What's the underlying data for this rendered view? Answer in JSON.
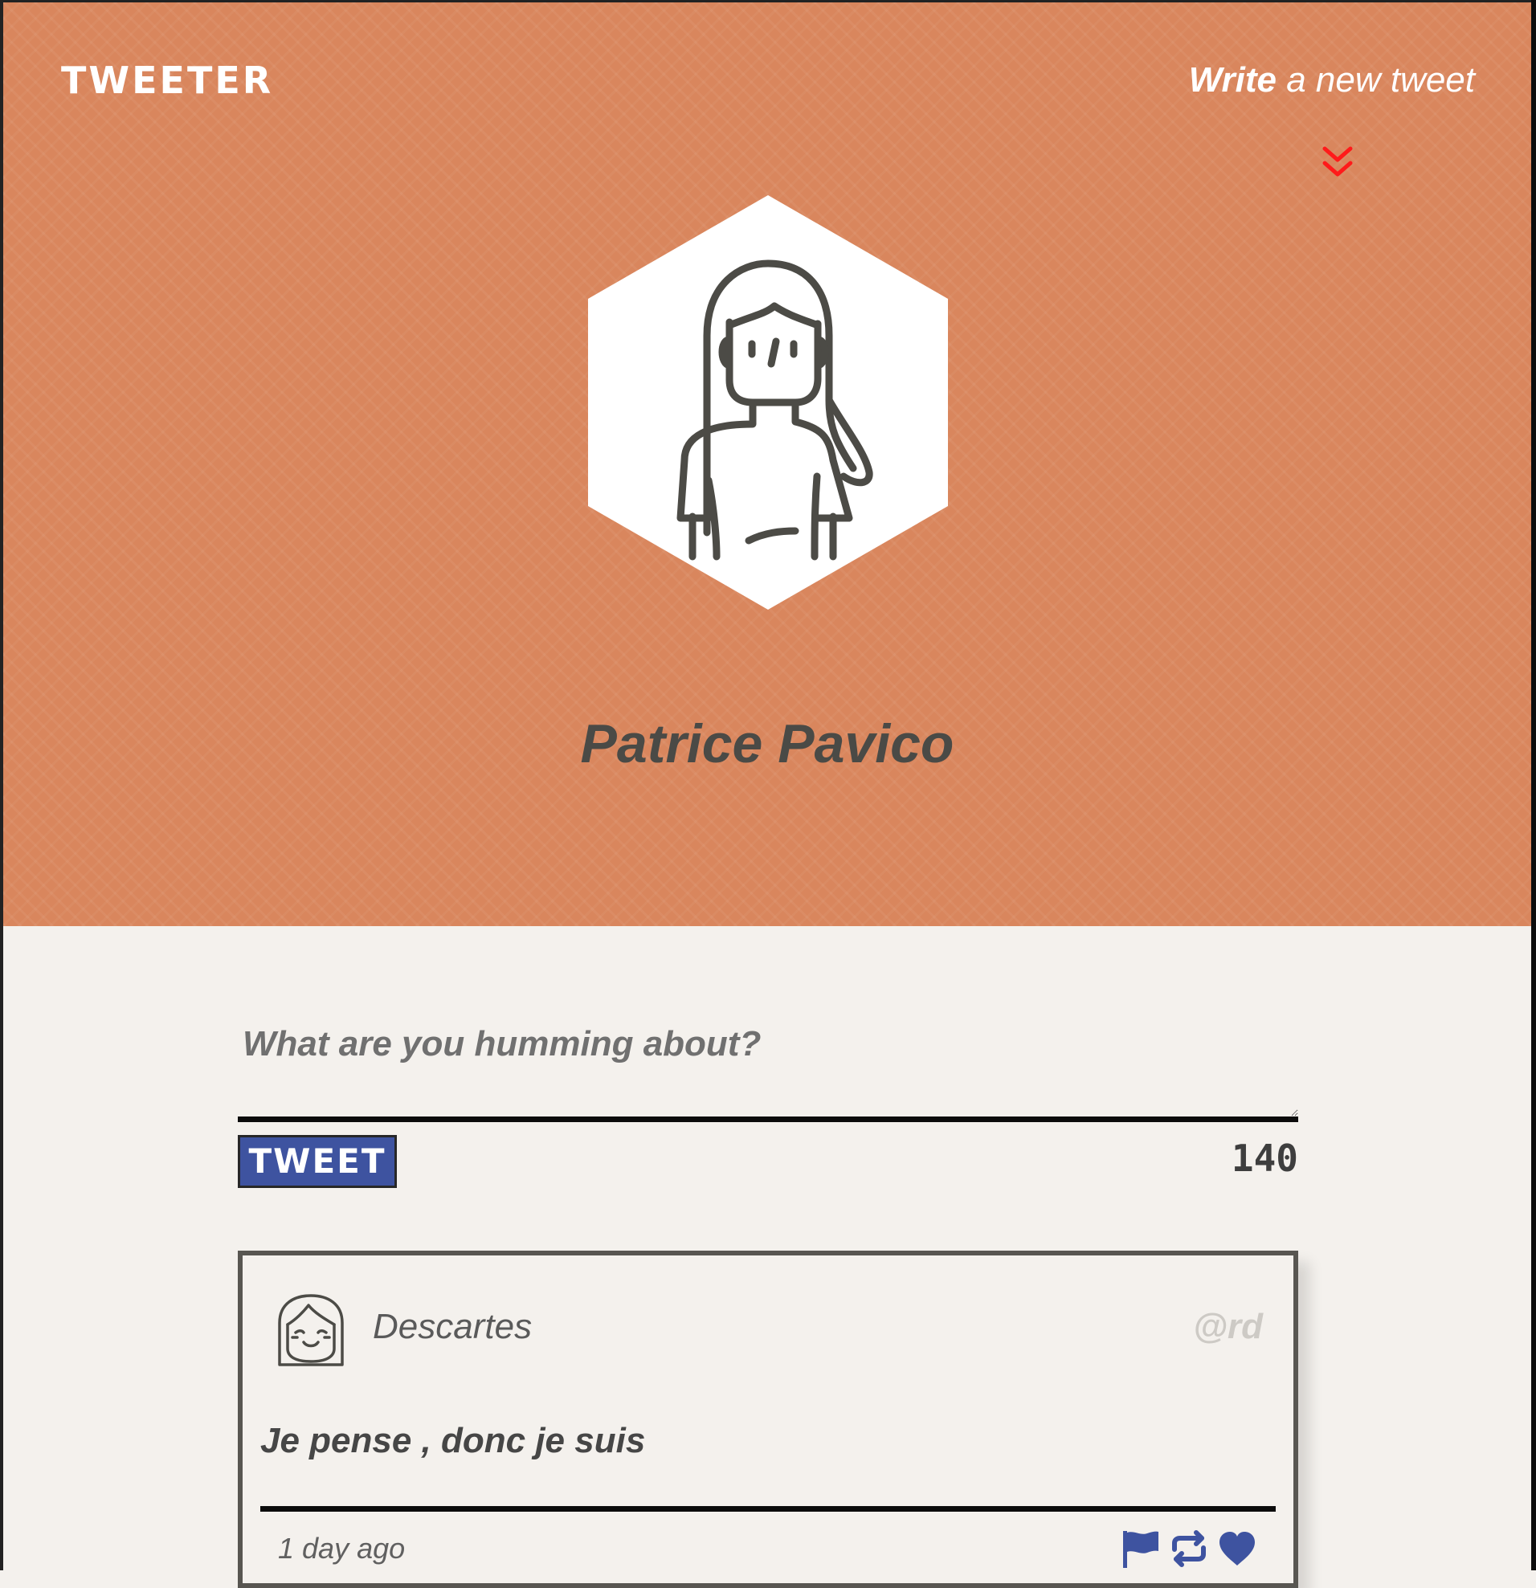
{
  "app": {
    "brand": "TWEETER"
  },
  "header": {
    "compose_toggle_strong": "Write",
    "compose_toggle_rest": "a new tweet",
    "user_name": "Patrice Pavico"
  },
  "compose": {
    "placeholder": "What are you humming about?",
    "value": "",
    "submit_label": "TWEET",
    "char_counter": "140"
  },
  "tweets": [
    {
      "author": "Descartes",
      "handle": "@rd",
      "text": "Je pense , donc je suis",
      "time": "1 day ago",
      "actions": [
        "flag-icon",
        "retweet-icon",
        "heart-icon"
      ]
    }
  ],
  "icons": {
    "chevron": "double-chevron-down-icon",
    "profile_avatar": "hexagon-avatar-icon",
    "tweet_avatar": "girl-avatar-icon"
  },
  "colors": {
    "header_bg": "#d9865d",
    "page_bg": "#f4f1ed",
    "accent_blue": "#3e53a0",
    "chevron_red": "#ff1a1a",
    "dark_text": "#4a4a46"
  }
}
